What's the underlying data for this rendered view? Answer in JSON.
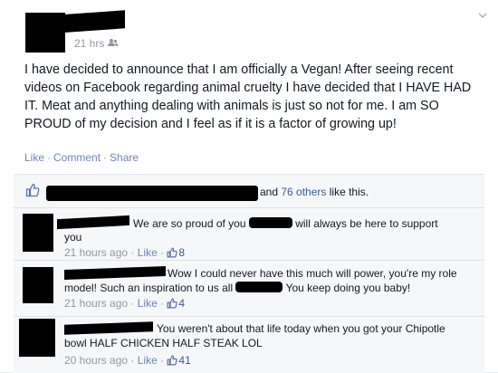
{
  "post": {
    "timestamp": "21 hrs",
    "audience_icon": "friends-icon",
    "text": "I have decided to announce that I am officially a Vegan! After seeing recent videos on Facebook regarding animal cruelty I have decided that I HAVE HAD IT. Meat and anything dealing with animals is just so not for me. I am SO PROUD of my decision and I feel as if it is a factor of growing up!",
    "actions": {
      "like": "Like",
      "comment": "Comment",
      "share": "Share",
      "separator": "·"
    }
  },
  "likes": {
    "and_text": "and ",
    "others_link": "76 others",
    "suffix": " like this."
  },
  "comments": [
    {
      "parts": [
        "We are so proud of you ",
        " will always be here to support",
        "you"
      ],
      "time": "21 hours ago",
      "like_label": "Like",
      "like_count": "8"
    },
    {
      "parts": [
        "Wow I could never have this much will power, you're my role",
        "model! Such an inspiration to us all ",
        " You keep doing you baby!"
      ],
      "time": "21 hours ago",
      "like_label": "Like",
      "like_count": "4"
    },
    {
      "parts": [
        "You weren't about that life today when you got your Chipotle",
        "bowl HALF CHICKEN HALF STEAK LOL"
      ],
      "time": "20 hours ago",
      "like_label": "Like",
      "like_count": "41"
    }
  ],
  "colors": {
    "link": "#3b5998",
    "muted": "#9197a3",
    "action": "#6d84b4",
    "ufi_bg": "#f6f7f9"
  }
}
